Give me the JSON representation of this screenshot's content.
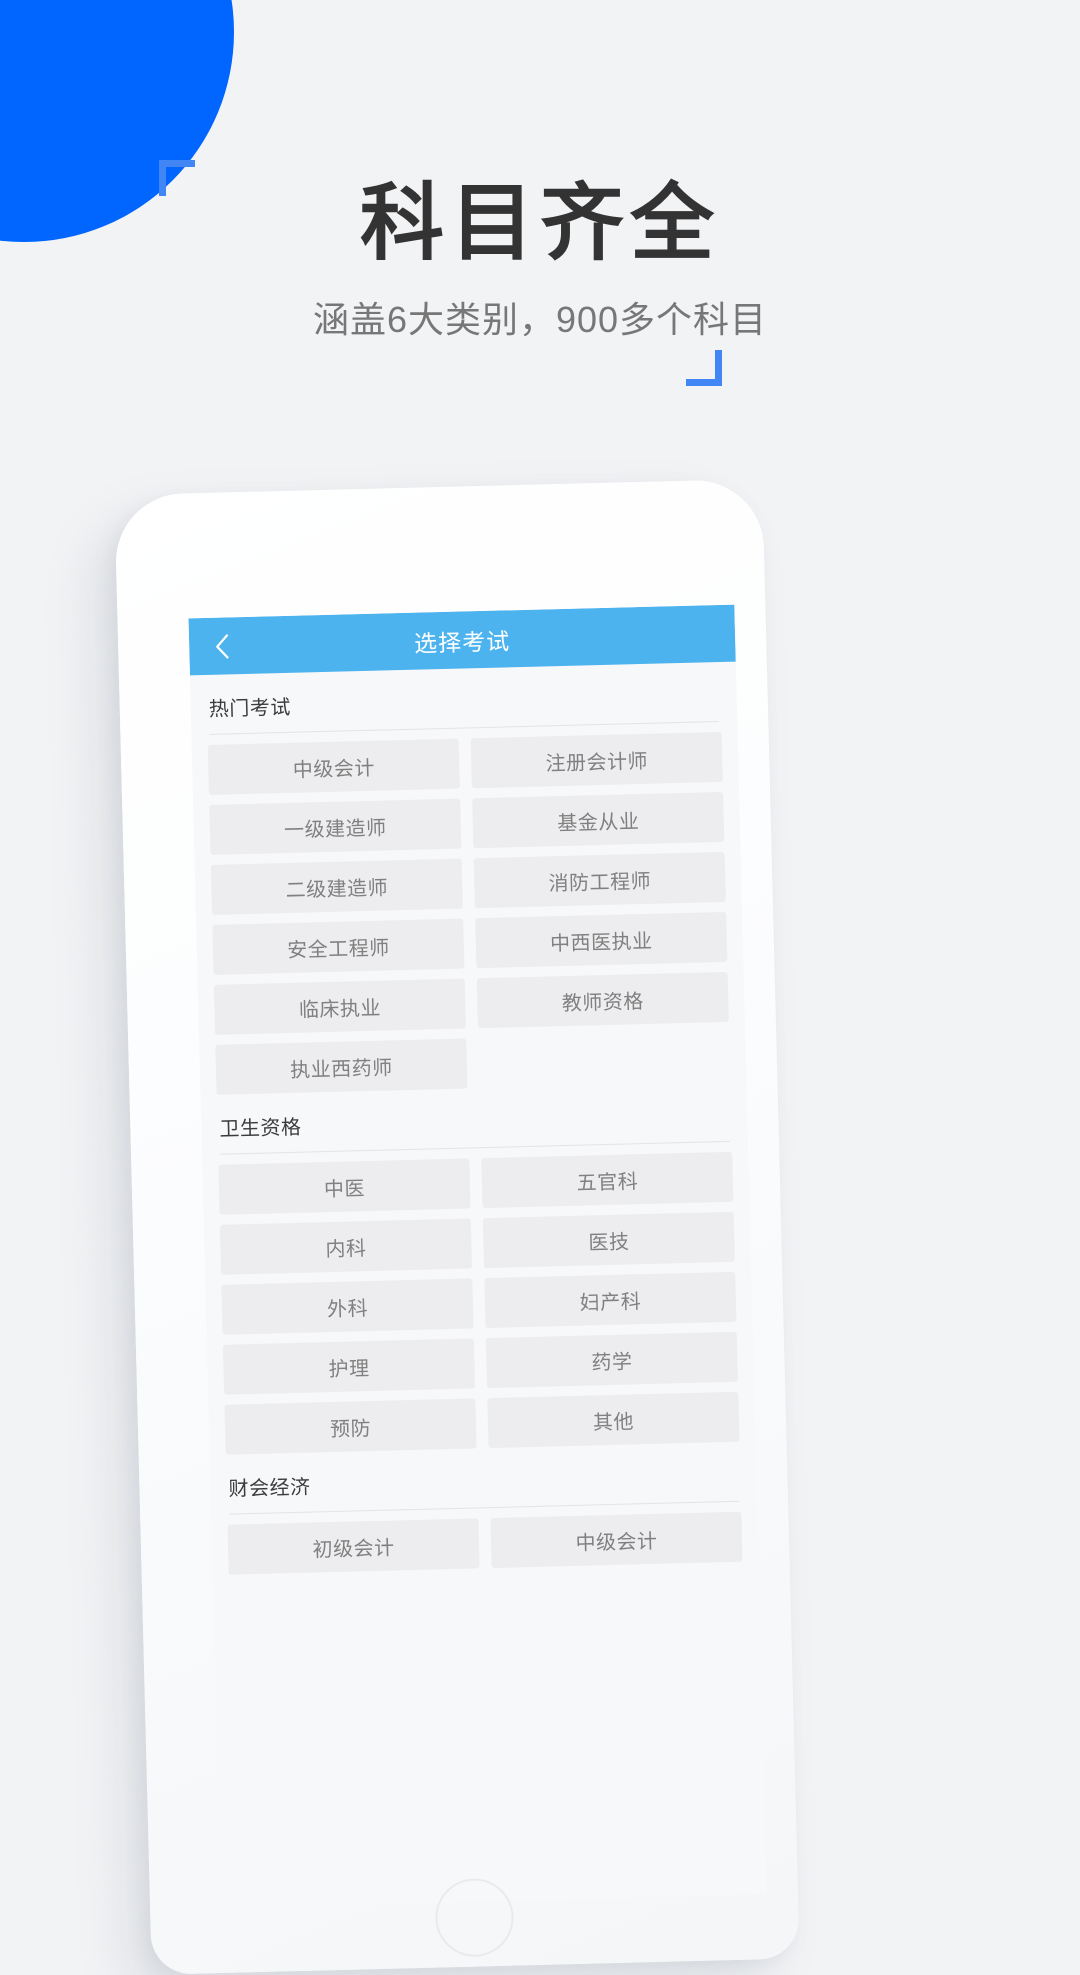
{
  "promo": {
    "headline": "科目齐全",
    "subheadline": "涵盖6大类别，900多个科目",
    "accent_blue": "#0066ff",
    "bracket_blue": "#4285f4",
    "background": "#f2f3f5"
  },
  "app": {
    "header": {
      "title": "选择考试",
      "back_icon": "chevron-left-icon",
      "bar_color": "#4cb3ee"
    },
    "sections": [
      {
        "title": "热门考试",
        "items": [
          "中级会计",
          "注册会计师",
          "一级建造师",
          "基金从业",
          "二级建造师",
          "消防工程师",
          "安全工程师",
          "中西医执业",
          "临床执业",
          "教师资格",
          "执业西药师"
        ]
      },
      {
        "title": "卫生资格",
        "items": [
          "中医",
          "五官科",
          "内科",
          "医技",
          "外科",
          "妇产科",
          "护理",
          "药学",
          "预防",
          "其他"
        ]
      },
      {
        "title": "财会经济",
        "items": [
          "初级会计",
          "中级会计"
        ]
      }
    ]
  }
}
